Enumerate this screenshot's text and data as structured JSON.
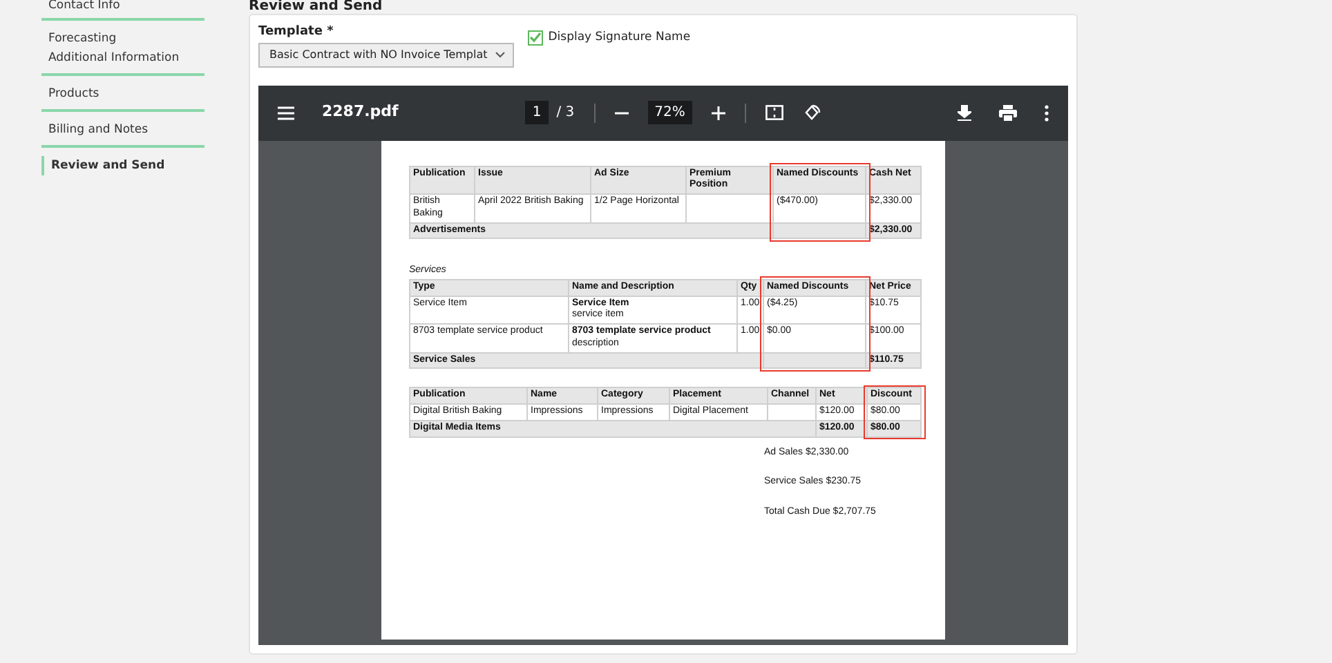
{
  "sidebar": {
    "items": [
      {
        "label": "Contact Info",
        "selected": false,
        "divider_after": true
      },
      {
        "label": "Forecasting",
        "selected": false,
        "divider_after": false
      },
      {
        "label": "Additional Information",
        "selected": false,
        "divider_after": true
      },
      {
        "label": "Products",
        "selected": false,
        "divider_after": true
      },
      {
        "label": "Billing and Notes",
        "selected": false,
        "divider_after": true
      },
      {
        "label": "Review and Send",
        "selected": true,
        "divider_after": false
      }
    ]
  },
  "heading": "Review and Send",
  "form": {
    "template_label": "Template *",
    "template_value": "Basic Contract with NO Invoice Templat",
    "signature_checkbox": {
      "label": "Display Signature Name",
      "checked": true
    }
  },
  "pdf": {
    "filename": "2287.pdf",
    "page": "1",
    "page_total": "/ 3",
    "zoom": "72%",
    "tables": [
      {
        "columns": [
          {
            "label": "Publication",
            "highlighted": false
          },
          {
            "label": "Issue",
            "highlighted": false
          },
          {
            "label": "Ad Size",
            "highlighted": false
          },
          {
            "label": "Premium Position",
            "highlighted": false
          },
          {
            "label": "Named Discounts",
            "highlighted": true
          },
          {
            "label": "Cash Net",
            "highlighted": false,
            "total": "$2,330.00"
          }
        ],
        "rows": [
          [
            "British Baking",
            "April 2022 British Baking",
            "1/2 Page Horizontal",
            null,
            "($470.00)",
            "$2,330.00"
          ]
        ],
        "total_label": "Advertisements"
      },
      {
        "caption": "Services",
        "columns": [
          {
            "label": "Type",
            "highlighted": false
          },
          {
            "label": "Name and Description",
            "highlighted": false
          },
          {
            "label": "Qty",
            "highlighted": false
          },
          {
            "label": "Named Discounts",
            "highlighted": true
          },
          {
            "label": "Net Price",
            "highlighted": false,
            "total": "$110.75"
          }
        ],
        "rows": [
          [
            "Service Item",
            {
              "name": "Service Item",
              "description": "service item"
            },
            "1.00",
            "($4.25)",
            "$10.75"
          ],
          [
            "8703 template service product",
            {
              "name": "8703 template service product",
              "description": "description"
            },
            "1.00",
            "$0.00",
            "$100.00"
          ]
        ],
        "total_label": "Service Sales"
      },
      {
        "columns": [
          {
            "label": "Publication",
            "highlighted": false
          },
          {
            "label": "Name",
            "highlighted": false
          },
          {
            "label": "Category",
            "highlighted": false
          },
          {
            "label": "Placement",
            "highlighted": false
          },
          {
            "label": "Channel",
            "highlighted": false
          },
          {
            "label": "Net",
            "highlighted": false,
            "total": "$120.00"
          },
          {
            "label": "Discount",
            "highlighted": true,
            "total": "$80.00"
          }
        ],
        "rows": [
          [
            "Digital British Baking",
            "Impressions",
            "Impressions",
            "Digital Placement",
            null,
            "$120.00",
            "$80.00"
          ]
        ],
        "total_label": "Digital Media Items"
      }
    ],
    "summary": [
      "Ad Sales $2,330.00",
      "Service Sales $230.75",
      "Total Cash Due $2,707.75"
    ]
  }
}
